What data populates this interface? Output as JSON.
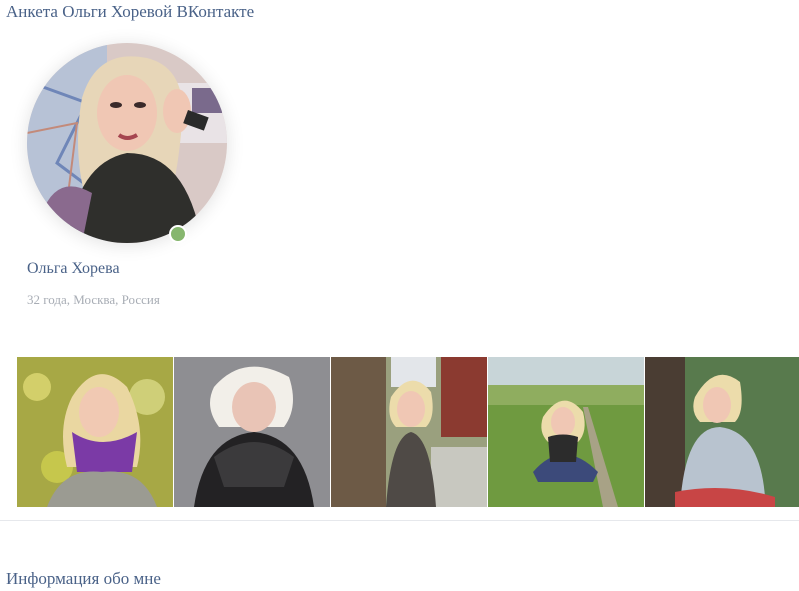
{
  "page": {
    "title": "Анкета Ольги Хоревой ВКонтакте"
  },
  "profile": {
    "name": "Ольга Хорева",
    "meta": "32 года, Москва, Россия",
    "online": true,
    "online_color": "#86b66e"
  },
  "photos": [
    {
      "name": "photo-1"
    },
    {
      "name": "photo-2"
    },
    {
      "name": "photo-3"
    },
    {
      "name": "photo-4"
    },
    {
      "name": "photo-5"
    }
  ],
  "sections": {
    "about_title": "Информация обо мне"
  },
  "colors": {
    "link": "#4a6288",
    "muted": "#a8adb5",
    "divider": "#e6e8ec"
  }
}
